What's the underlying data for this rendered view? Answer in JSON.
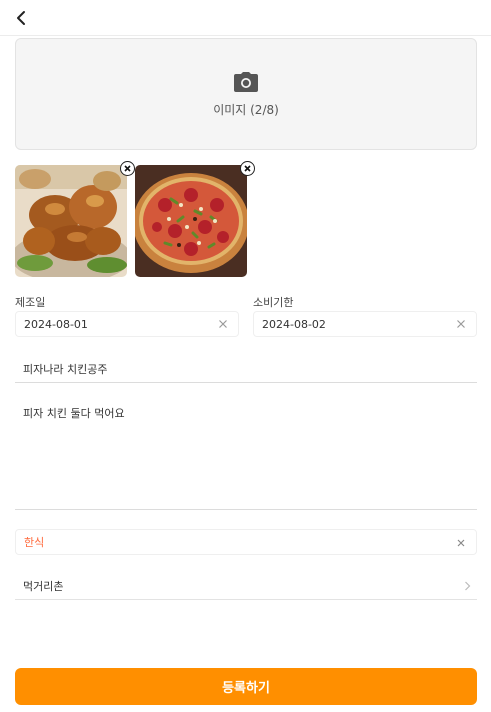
{
  "header": {
    "back_icon": "chevron-left-icon"
  },
  "upload": {
    "icon": "camera-icon",
    "label": "이미지 (2/8)"
  },
  "photos": [
    {
      "subject": "fried chicken",
      "remove_icon": "close-icon"
    },
    {
      "subject": "pizza",
      "remove_icon": "close-icon"
    }
  ],
  "dates": {
    "manufacture_label": "제조일",
    "manufacture_value": "2024-08-01",
    "expiry_label": "소비기한",
    "expiry_value": "2024-08-02"
  },
  "form": {
    "title_value": "피자나라 치킨공주",
    "description_value": "피자 치킨 둘다 먹어요",
    "category_value": "한식",
    "location_value": "먹거리촌"
  },
  "submit_label": "등록하기",
  "colors": {
    "accent": "#ff8f00",
    "category_text": "#ff6a3d",
    "upload_bg": "#f5f5f5"
  }
}
